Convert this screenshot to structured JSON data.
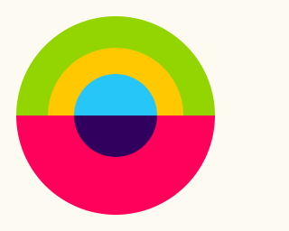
{
  "palette": {
    "background": "#fdfaf2",
    "outer_top": "#93d500",
    "middle_top": "#ffc800",
    "inner_top": "#26c6f9",
    "bottom_half": "#ff005a",
    "inner_bottom": "#31005e"
  }
}
